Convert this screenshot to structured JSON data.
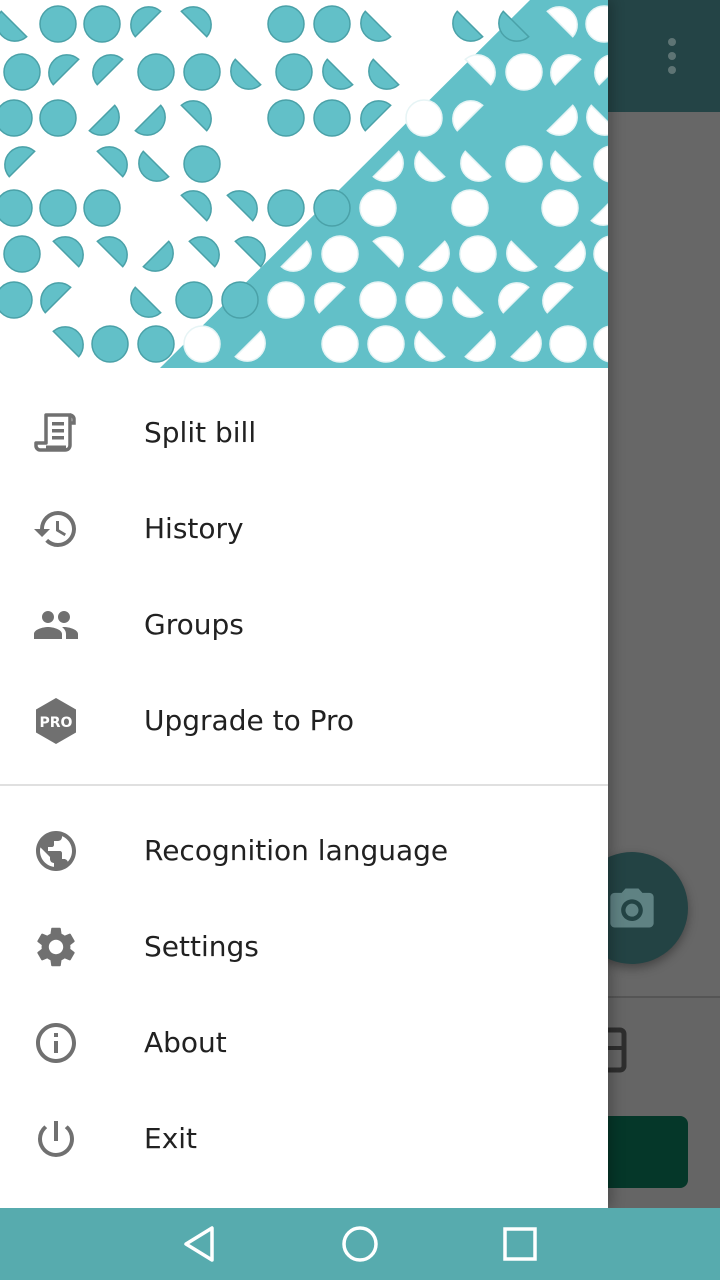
{
  "colors": {
    "header_teal": "#62c0c8",
    "header_teal_stroke": "#4aa1a8",
    "icon_grey": "#707070",
    "text": "#212121",
    "nav_bar": "#57abae",
    "toolbar": "#244446",
    "dark_button": "#053729"
  },
  "background_app": {
    "overflow_icon": "more-vert-icon",
    "fab_icon": "camera-icon"
  },
  "drawer": {
    "primary_items": [
      {
        "id": "split-bill",
        "label": "Split bill",
        "icon": "receipt-icon"
      },
      {
        "id": "history",
        "label": "History",
        "icon": "history-icon"
      },
      {
        "id": "groups",
        "label": "Groups",
        "icon": "people-icon"
      },
      {
        "id": "upgrade-pro",
        "label": "Upgrade to Pro",
        "icon": "pro-badge-icon",
        "badge_text": "PRO"
      }
    ],
    "secondary_items": [
      {
        "id": "recognition-language",
        "label": "Recognition language",
        "icon": "globe-icon"
      },
      {
        "id": "settings",
        "label": "Settings",
        "icon": "gear-icon"
      },
      {
        "id": "about",
        "label": "About",
        "icon": "info-icon"
      },
      {
        "id": "exit",
        "label": "Exit",
        "icon": "power-icon"
      }
    ]
  },
  "nav_bar": {
    "buttons": [
      "back-icon",
      "home-icon",
      "recents-icon"
    ]
  }
}
